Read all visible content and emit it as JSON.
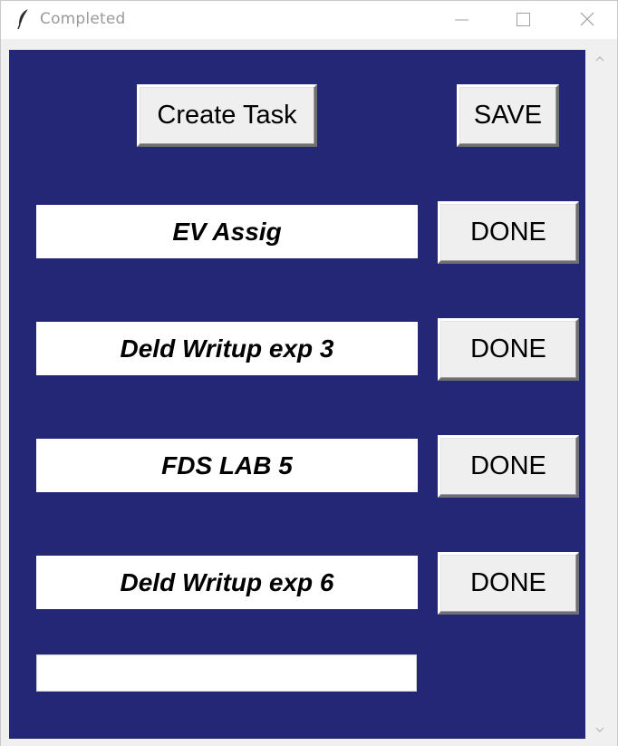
{
  "window": {
    "title": "Completed"
  },
  "toolbar": {
    "create_label": "Create Task",
    "save_label": "SAVE"
  },
  "tasks": [
    {
      "text": "EV Assig",
      "done_label": "DONE"
    },
    {
      "text": "Deld Writup exp 3",
      "done_label": "DONE"
    },
    {
      "text": "FDS LAB 5",
      "done_label": "DONE"
    },
    {
      "text": "Deld Writup exp 6",
      "done_label": "DONE"
    }
  ],
  "new_task": {
    "value": ""
  },
  "colors": {
    "canvas_background": "#232775",
    "button_face": "#efefef",
    "entry_background": "#ffffff"
  },
  "icons": {
    "app": "feather-icon",
    "minimize": "minimize-icon",
    "maximize": "maximize-icon",
    "close": "close-icon",
    "scroll_up": "chevron-up-icon",
    "scroll_down": "chevron-down-icon"
  }
}
